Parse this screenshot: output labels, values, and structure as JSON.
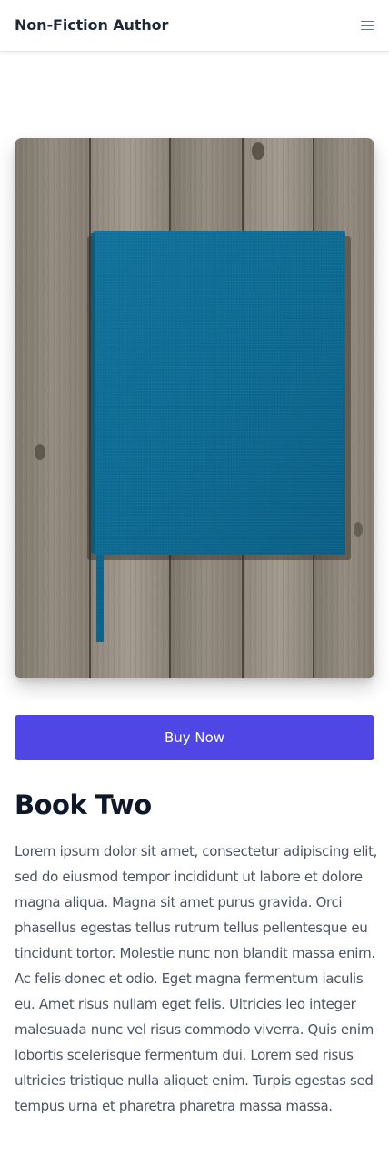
{
  "header": {
    "brand": "Non-Fiction Author",
    "menu_icon": "hamburger-menu-icon"
  },
  "book": {
    "cover_image": "blue-book-on-wooden-table",
    "buy_label": "Buy Now",
    "title": "Book Two",
    "description": "Lorem ipsum dolor sit amet, consectetur adipiscing elit, sed do eiusmod tempor incididunt ut labore et dolore magna aliqua. Magna sit amet purus gravida. Orci phasellus egestas tellus rutrum tellus pellentesque eu tincidunt tortor. Molestie nunc non blandit massa enim. Ac felis donec et odio. Eget magna fermentum iaculis eu. Amet risus nullam eget felis. Ultricies leo integer malesuada nunc vel risus commodo viverra. Quis enim lobortis scelerisque fermentum dui. Lorem sed risus ultricies tristique nulla aliquet enim. Turpis egestas sed tempus urna et pharetra pharetra massa massa."
  },
  "colors": {
    "accent": "#4f46e5",
    "heading": "#0f172a",
    "body_text": "#4b5563",
    "book_cover": "#0e6a92",
    "wood": "#8a8275"
  }
}
